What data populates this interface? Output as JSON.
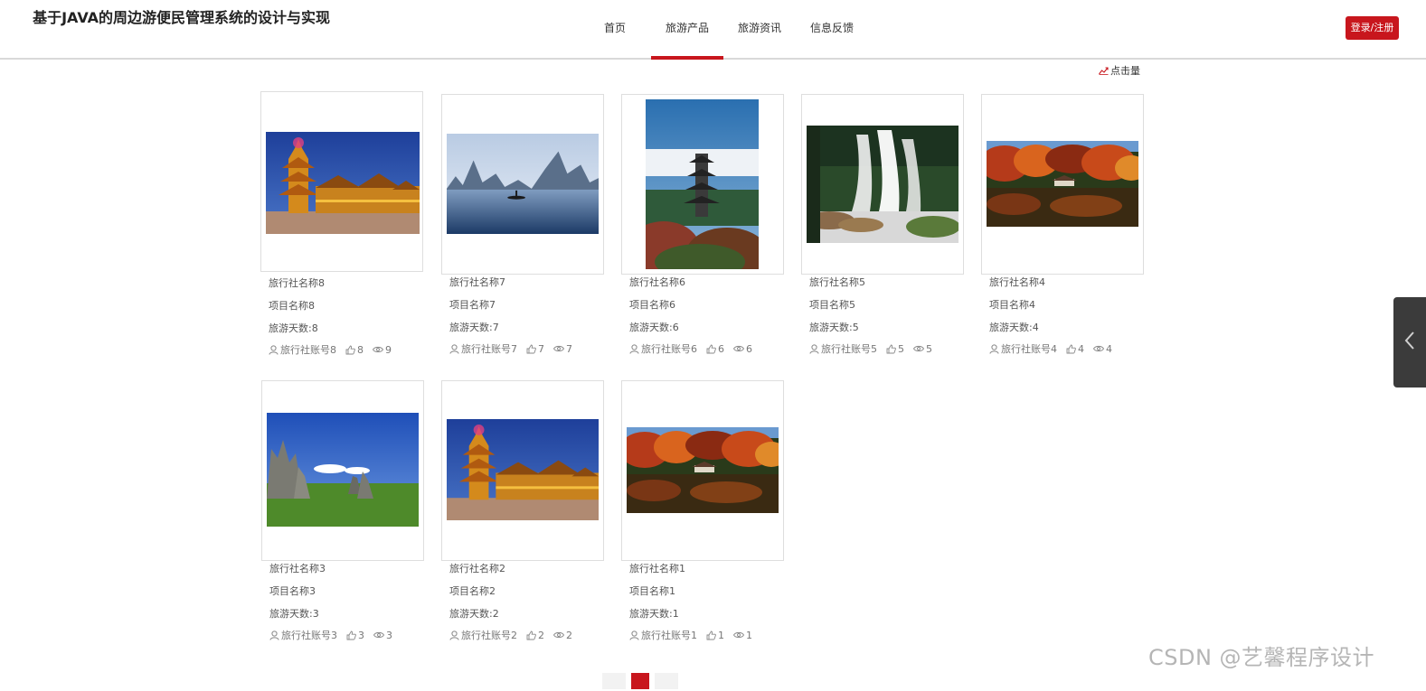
{
  "header": {
    "site_title": "基于JAVA的周边游便民管理系统的设计与实现",
    "nav": [
      {
        "label": "首页",
        "active": false
      },
      {
        "label": "旅游产品",
        "active": true
      },
      {
        "label": "旅游资讯",
        "active": false
      },
      {
        "label": "信息反馈",
        "active": false
      }
    ],
    "login_label": "登录/注册"
  },
  "sort": {
    "icon": "trend-chart-icon",
    "label": "点击量"
  },
  "products": [
    {
      "agency": "旅行社名称8",
      "project": "项目名称8",
      "days": "旅游天数:8",
      "account": "旅行社账号8",
      "likes": "8",
      "views": "9",
      "scene": "drum-tower"
    },
    {
      "agency": "旅行社名称7",
      "project": "项目名称7",
      "days": "旅游天数:7",
      "account": "旅行社账号7",
      "likes": "7",
      "views": "7",
      "scene": "karst-river"
    },
    {
      "agency": "旅行社名称6",
      "project": "项目名称6",
      "days": "旅游天数:6",
      "account": "旅行社账号6",
      "likes": "6",
      "views": "6",
      "scene": "pagoda"
    },
    {
      "agency": "旅行社名称5",
      "project": "项目名称5",
      "days": "旅游天数:5",
      "account": "旅行社账号5",
      "likes": "5",
      "views": "5",
      "scene": "waterfall"
    },
    {
      "agency": "旅行社名称4",
      "project": "项目名称4",
      "days": "旅游天数:4",
      "account": "旅行社账号4",
      "likes": "4",
      "views": "4",
      "scene": "autumn-lake"
    },
    {
      "agency": "旅行社名称3",
      "project": "项目名称3",
      "days": "旅游天数:3",
      "account": "旅行社账号3",
      "likes": "3",
      "views": "3",
      "scene": "stone-forest"
    },
    {
      "agency": "旅行社名称2",
      "project": "项目名称2",
      "days": "旅游天数:2",
      "account": "旅行社账号2",
      "likes": "2",
      "views": "2",
      "scene": "drum-tower"
    },
    {
      "agency": "旅行社名称1",
      "project": "项目名称1",
      "days": "旅游天数:1",
      "account": "旅行社账号1",
      "likes": "1",
      "views": "1",
      "scene": "autumn-lake"
    }
  ],
  "icons": {
    "user": "user-icon",
    "like": "thumbs-up-icon",
    "view": "eye-icon"
  },
  "colors": {
    "accent": "#c8161d",
    "side_tab": "#3b3b3b"
  },
  "watermark": "CSDN @艺馨程序设计"
}
